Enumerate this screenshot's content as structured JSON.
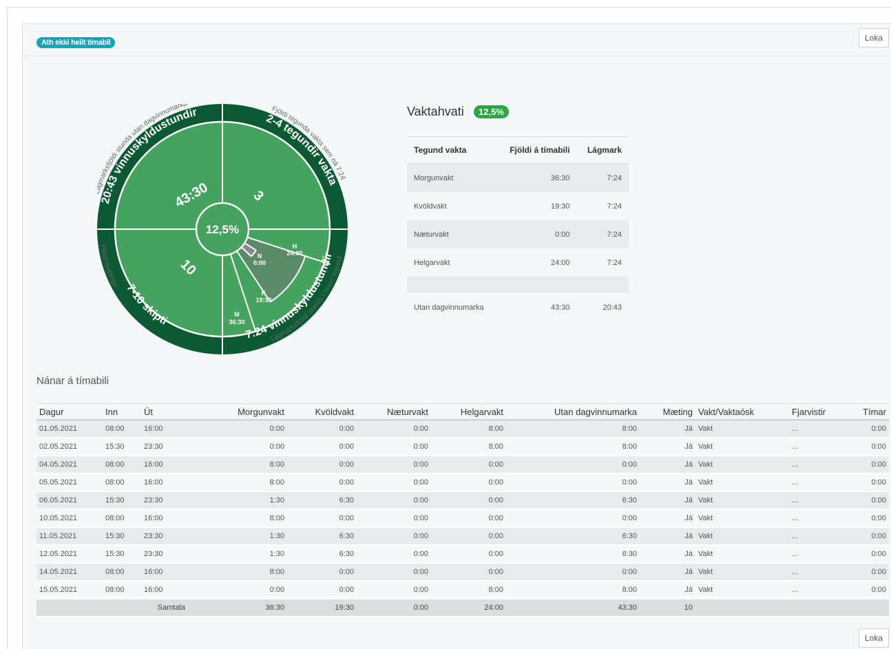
{
  "header": {
    "warning_badge": "Ath ekki heilt tímabil",
    "close_label": "Loka"
  },
  "wheel": {
    "center_value": "12,5%",
    "quadrants": {
      "top_left_value": "43:30",
      "top_right_value": "3",
      "bottom_left_value": "10"
    },
    "slices": [
      {
        "letter": "H",
        "value": "24:00"
      },
      {
        "letter": "N",
        "value": "0:00"
      },
      {
        "letter": "K",
        "value": "19:30"
      },
      {
        "letter": "M",
        "value": "36:30"
      }
    ],
    "inner_ring": {
      "top_left": "20:43 vinnuskyldustundir",
      "top_right": "2-4 tegundir vakta",
      "bottom_left": "7-10 skipti",
      "bottom_right": "7:24 vinnuskyldustundir"
    },
    "outer_ring": {
      "top_left": "Lágmarksfjöldi stunda utan dagvinnumarka",
      "top_right": "Fjöldi tegunda vakta sem ná 7:24",
      "bottom_left": "Fjöldi mætinga",
      "bottom_right": "Lágmarksfjöldi stunda í hverri tegund"
    },
    "colors": {
      "dark": "#0b5a34",
      "main": "#46a35f",
      "slice_dark": "#5a8a68",
      "slice_gray": "#8a8a8a"
    }
  },
  "summary": {
    "title": "Vaktahvati",
    "badge": "12,5%",
    "columns": [
      "Tegund vakta",
      "Fjöldi á tímabili",
      "Lágmark"
    ],
    "rows": [
      {
        "type": "Morgunvakt",
        "count": "36:30",
        "min": "7:24"
      },
      {
        "type": "Kvöldvakt",
        "count": "19:30",
        "min": "7:24"
      },
      {
        "type": "Næturvakt",
        "count": "0:00",
        "min": "7:24"
      },
      {
        "type": "Helgarvakt",
        "count": "24:00",
        "min": "7:24"
      }
    ],
    "footer": {
      "type": "Utan dagvinnumarka",
      "count": "43:30",
      "min": "20:43"
    }
  },
  "details": {
    "title": "Nánar á tímabili",
    "columns": [
      "Dagur",
      "Inn",
      "Út",
      "Morgunvakt",
      "Kvöldvakt",
      "Næturvakt",
      "Helgarvakt",
      "Utan dagvinnumarka",
      "Mæting",
      "Vakt/Vaktaósk",
      "Fjarvistir",
      "Tímar"
    ],
    "rows": [
      [
        "01.05.2021",
        "08:00",
        "16:00",
        "0:00",
        "0:00",
        "0:00",
        "8:00",
        "8:00",
        "Já",
        "Vakt",
        "...",
        "0:00"
      ],
      [
        "02.05.2021",
        "15:30",
        "23:30",
        "0:00",
        "0:00",
        "0:00",
        "8:00",
        "8:00",
        "Já",
        "Vakt",
        "...",
        "0:00"
      ],
      [
        "04.05.2021",
        "08:00",
        "16:00",
        "8:00",
        "0:00",
        "0:00",
        "0:00",
        "0:00",
        "Já",
        "Vakt",
        "...",
        "0:00"
      ],
      [
        "05.05.2021",
        "08:00",
        "16:00",
        "8:00",
        "0:00",
        "0:00",
        "0:00",
        "0:00",
        "Já",
        "Vakt",
        "...",
        "0:00"
      ],
      [
        "06.05.2021",
        "15:30",
        "23:30",
        "1:30",
        "6:30",
        "0:00",
        "0:00",
        "6:30",
        "Já",
        "Vakt",
        "...",
        "0:00"
      ],
      [
        "10.05.2021",
        "08:00",
        "16:00",
        "8:00",
        "0:00",
        "0:00",
        "0:00",
        "0:00",
        "Já",
        "Vakt",
        "...",
        "0:00"
      ],
      [
        "11.05.2021",
        "15:30",
        "23:30",
        "1:30",
        "6:30",
        "0:00",
        "0:00",
        "6:30",
        "Já",
        "Vakt",
        "...",
        "0:00"
      ],
      [
        "12.05.2021",
        "15:30",
        "23:30",
        "1:30",
        "6:30",
        "0:00",
        "0:00",
        "6:30",
        "Já",
        "Vakt",
        "...",
        "0:00"
      ],
      [
        "14.05.2021",
        "08:00",
        "16:00",
        "8:00",
        "0:00",
        "0:00",
        "0:00",
        "0:00",
        "Já",
        "Vakt",
        "...",
        "0:00"
      ],
      [
        "15.05.2021",
        "08:00",
        "16:00",
        "0:00",
        "0:00",
        "0:00",
        "8:00",
        "8:00",
        "Já",
        "Vakt",
        "...",
        "0:00"
      ]
    ],
    "total": {
      "label": "Samtala",
      "morgun": "36:30",
      "kvold": "19:30",
      "naetur": "0:00",
      "helgar": "24:00",
      "utan": "43:30",
      "maeting": "10"
    }
  }
}
